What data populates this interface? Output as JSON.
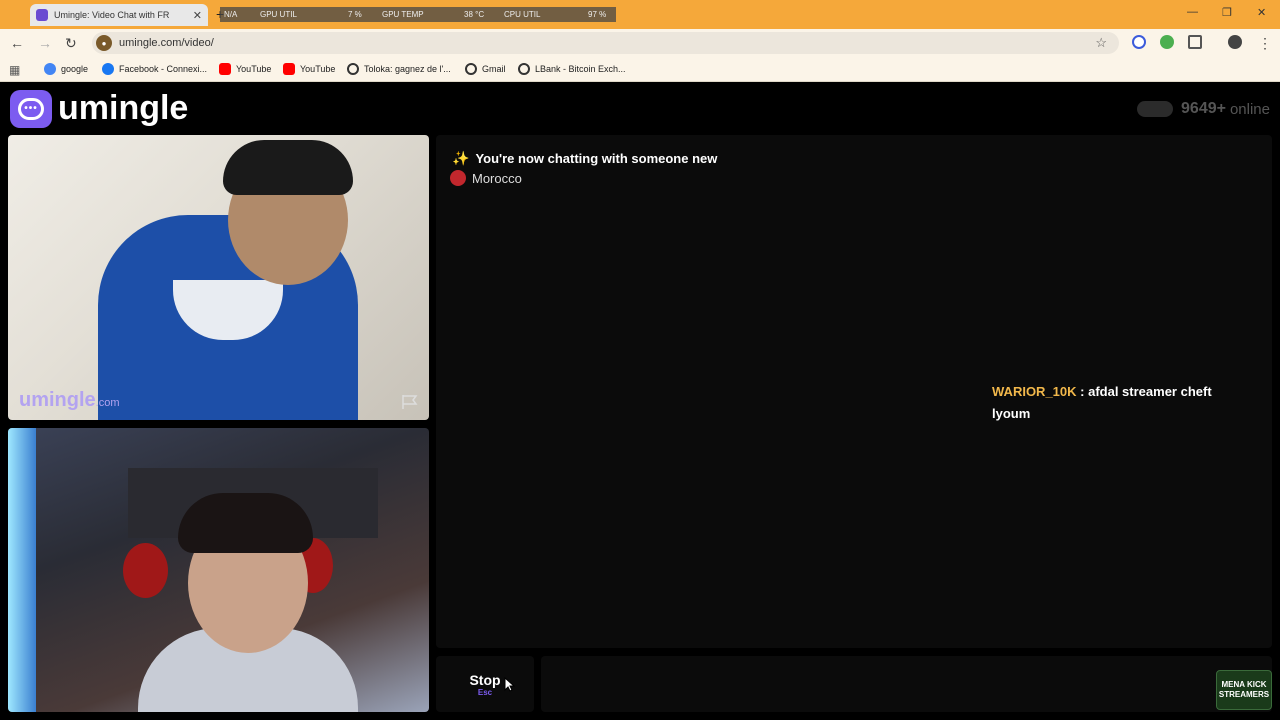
{
  "browser": {
    "tab_title": "Umingle: Video Chat with FR",
    "overlay": {
      "na": "N/A",
      "gpu_util_label": "GPU UTIL",
      "gpu_util_value": "7 %",
      "gpu_temp_label": "GPU TEMP",
      "gpu_temp_value": "38 °C",
      "cpu_util_label": "CPU UTIL",
      "cpu_util_value": "97 %"
    },
    "url": "umingle.com/video/",
    "bookmarks": [
      {
        "label": "google",
        "color": "#4285f4"
      },
      {
        "label": "Facebook - Connexi...",
        "color": "#1877f2"
      },
      {
        "label": "YouTube",
        "color": "#ff0000"
      },
      {
        "label": "YouTube",
        "color": "#ff0000"
      },
      {
        "label": "Toloka: gagnez de l'...",
        "color": "#333333"
      },
      {
        "label": "Gmail",
        "color": "#333333"
      },
      {
        "label": "LBank - Bitcoin Exch...",
        "color": "#333333"
      }
    ]
  },
  "site": {
    "logo_text": "umingle",
    "online_count": "9649+",
    "online_label": "online",
    "watermark": "umingle",
    "watermark_suffix": ".com"
  },
  "chat": {
    "status": "You're now chatting with someone new",
    "country": "Morocco",
    "overlay_user": "WARIOR_10K",
    "overlay_text": ": afdal streamer cheft lyoum"
  },
  "controls": {
    "stop_label": "Stop",
    "stop_key": "Esc",
    "message_placeholder": ""
  },
  "stream_badge": {
    "line1": "MENA KICK",
    "line2": "STREAMERS"
  },
  "colors": {
    "accent": "#7c5cf0",
    "titlebar": "#f5a83a",
    "overlay_user": "#f2b84b"
  }
}
